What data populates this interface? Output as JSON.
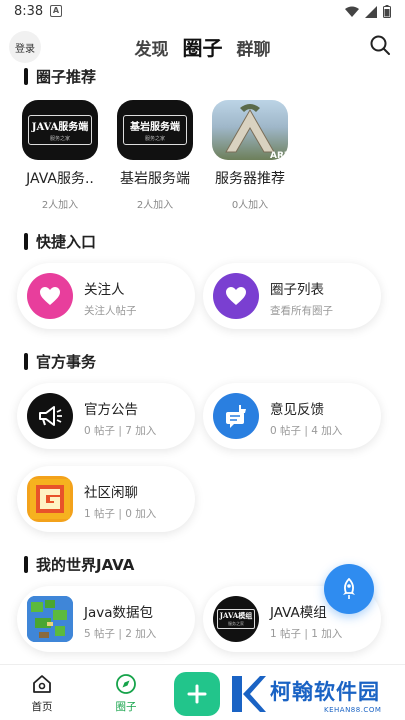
{
  "status": {
    "time": "8:38",
    "notif_letter": "A"
  },
  "header": {
    "login_label": "登录",
    "tabs": [
      {
        "label": "发现",
        "active": false
      },
      {
        "label": "圈子",
        "active": true
      },
      {
        "label": "群聊",
        "active": false
      }
    ]
  },
  "sections": {
    "recommend": "圈子推荐",
    "shortcuts": "快捷入口",
    "official": "官方事务",
    "java": "我的世界JAVA"
  },
  "recommend": [
    {
      "name": "JAVA服务..",
      "count": "2人加入",
      "plaque": "JAVA服务端",
      "plaque_sub": "服务之家"
    },
    {
      "name": "基岩服务端",
      "count": "2人加入",
      "plaque": "基岩服务端",
      "plaque_sub": "服务之家"
    },
    {
      "name": "服务器推荐",
      "count": "0人加入",
      "logo_text": "ARK"
    }
  ],
  "shortcuts": [
    {
      "title": "关注人",
      "sub": "关注人帖子",
      "color": "#e83e9c"
    },
    {
      "title": "圈子列表",
      "sub": "查看所有圈子",
      "color": "#7a3fd1"
    }
  ],
  "official": [
    {
      "title": "官方公告",
      "sub": "0 帖子 | 7 加入"
    },
    {
      "title": "意见反馈",
      "sub": "0 帖子 | 4 加入"
    },
    {
      "title": "社区闲聊",
      "sub": "1 帖子 | 0 加入"
    }
  ],
  "java": [
    {
      "title": "Java数据包",
      "sub": "5 帖子 | 2 加入"
    },
    {
      "title": "JAVA模组",
      "sub": "1 帖子 | 1 加入",
      "plaque": "JAVA模组",
      "plaque_sub": "服务之家"
    }
  ],
  "nav": [
    {
      "label": "首页",
      "active": false
    },
    {
      "label": "圈子",
      "active": true
    }
  ],
  "watermark": {
    "title": "柯翰软件园",
    "sub": "KEHAN88.COM"
  },
  "colors": {
    "accent_green": "#16a34a",
    "add_button": "#22c58b",
    "fab_blue": "#2f8cf0",
    "watermark_blue": "#1a63c4"
  }
}
